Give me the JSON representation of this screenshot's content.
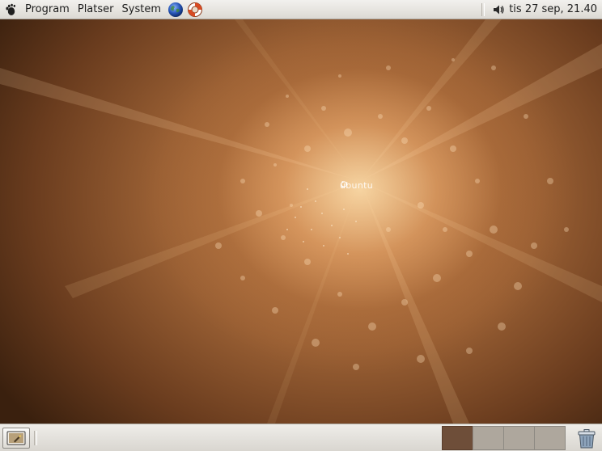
{
  "top_panel": {
    "menus": [
      {
        "label": "Program"
      },
      {
        "label": "Platser"
      },
      {
        "label": "System"
      }
    ],
    "launchers": [
      {
        "icon": "web-browser-globe-icon"
      },
      {
        "icon": "help-lifebuoy-icon"
      }
    ],
    "clock": "tis 27 sep, 21.40",
    "volume_icon": "speaker-volume-icon"
  },
  "desktop": {
    "wallpaper_logo_text": "ubuntu",
    "colors": {
      "center": "#ffe2b0",
      "mid": "#c88850",
      "edge": "#3a200e"
    }
  },
  "bottom_panel": {
    "show_desktop_icon": "show-desktop-icon",
    "workspaces": [
      {
        "active": true
      },
      {
        "active": false
      },
      {
        "active": false
      },
      {
        "active": false
      }
    ],
    "trash_icon": "trash-icon"
  }
}
